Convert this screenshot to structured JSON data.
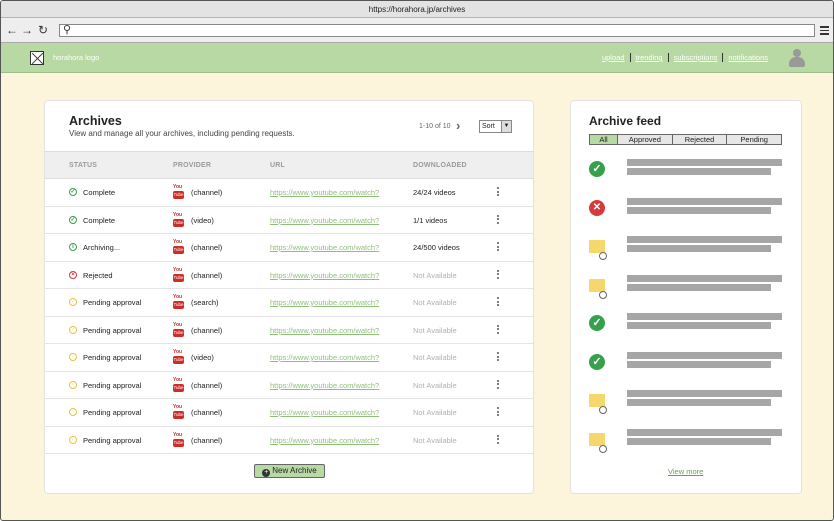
{
  "browser": {
    "url": "https://horahora.jp/archives",
    "back_icon": "arrow-left",
    "forward_icon": "arrow-right",
    "reload_icon": "reload",
    "search_icon": "magnifier",
    "address_value": ""
  },
  "appbar": {
    "logo_text": "horahora logo",
    "links": [
      "upload",
      "trending",
      "subscriptions",
      "notifications"
    ]
  },
  "archives": {
    "title": "Archives",
    "subtitle": "View and manage all your archives, including pending requests.",
    "pager": "1-10 of 10",
    "sort_label": "Sort",
    "columns": [
      "STATUS",
      "PROVIDER",
      "URL",
      "DOWNLOADED"
    ],
    "rows": [
      {
        "status": "Complete",
        "status_type": "ok",
        "provider_type": "(channel)",
        "url": "https://www.youtube.com/watch?",
        "downloaded": "24/24 videos"
      },
      {
        "status": "Complete",
        "status_type": "ok",
        "provider_type": "(video)",
        "url": "https://www.youtube.com/watch?",
        "downloaded": "1/1 videos"
      },
      {
        "status": "Archiving...",
        "status_type": "archiving",
        "provider_type": "(channel)",
        "url": "https://www.youtube.com/watch?",
        "downloaded": "24/500 videos"
      },
      {
        "status": "Rejected",
        "status_type": "rejected",
        "provider_type": "(channel)",
        "url": "https://www.youtube.com/watch?",
        "downloaded": "Not Available"
      },
      {
        "status": "Pending approval",
        "status_type": "pending",
        "provider_type": "(search)",
        "url": "https://www.youtube.com/watch?",
        "downloaded": "Not Available"
      },
      {
        "status": "Pending approval",
        "status_type": "pending",
        "provider_type": "(channel)",
        "url": "https://www.youtube.com/watch?",
        "downloaded": "Not Available"
      },
      {
        "status": "Pending approval",
        "status_type": "pending",
        "provider_type": "(video)",
        "url": "https://www.youtube.com/watch?",
        "downloaded": "Not Available"
      },
      {
        "status": "Pending approval",
        "status_type": "pending",
        "provider_type": "(channel)",
        "url": "https://www.youtube.com/watch?",
        "downloaded": "Not Available"
      },
      {
        "status": "Pending approval",
        "status_type": "pending",
        "provider_type": "(channel)",
        "url": "https://www.youtube.com/watch?",
        "downloaded": "Not Available"
      },
      {
        "status": "Pending approval",
        "status_type": "pending",
        "provider_type": "(channel)",
        "url": "https://www.youtube.com/watch?",
        "downloaded": "Not Available"
      }
    ],
    "new_button": "New Archive"
  },
  "feed": {
    "title": "Archive feed",
    "tabs": [
      "All",
      "Approved",
      "Rejected",
      "Pending"
    ],
    "active_tab": "All",
    "items": [
      {
        "icon": "check-circle-icon"
      },
      {
        "icon": "x-circle-icon"
      },
      {
        "icon": "pending-folder-icon"
      },
      {
        "icon": "pending-folder-icon"
      },
      {
        "icon": "check-circle-icon"
      },
      {
        "icon": "check-circle-icon"
      },
      {
        "icon": "pending-folder-icon"
      },
      {
        "icon": "pending-folder-icon"
      }
    ],
    "view_more": "View more"
  },
  "colors": {
    "accent_green": "#b8d8a4",
    "ok_green": "#37a04d",
    "rejected_red": "#d43b3b",
    "pending_yellow": "#e8c04a",
    "page_bg": "#fdf4dc"
  }
}
